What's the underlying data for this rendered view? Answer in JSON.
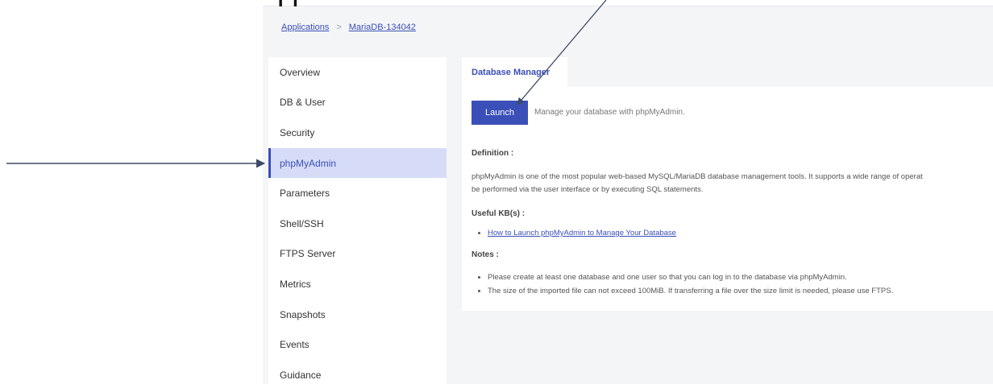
{
  "top_glyph": "[ ]",
  "breadcrumb": {
    "root": "Applications",
    "separator": ">",
    "current": "MariaDB-134042"
  },
  "sidebar": {
    "items": [
      {
        "label": "Overview"
      },
      {
        "label": "DB & User"
      },
      {
        "label": "Security"
      },
      {
        "label": "phpMyAdmin",
        "active": true
      },
      {
        "label": "Parameters"
      },
      {
        "label": "Shell/SSH"
      },
      {
        "label": "FTPS Server"
      },
      {
        "label": "Metrics"
      },
      {
        "label": "Snapshots"
      },
      {
        "label": "Events"
      },
      {
        "label": "Guidance"
      }
    ]
  },
  "tab": {
    "label": "Database Manager"
  },
  "launch": {
    "button_label": "Launch",
    "description": "Manage your database with phpMyAdmin."
  },
  "definition": {
    "heading": "Definition :",
    "line1": "phpMyAdmin is one of the most popular web-based MySQL/MariaDB database management tools. It supports a wide range of operat",
    "line2": "be performed via the user interface or by executing SQL statements."
  },
  "useful_kb": {
    "heading": "Useful KB(s) :",
    "link": "How to Launch phpMyAdmin to Manage Your Database"
  },
  "notes": {
    "heading": "Notes :",
    "items": [
      "Please create at least one database and one user so that you can log in to the database via phpMyAdmin.",
      "The size of the imported file can not exceed 100MiB. If transferring a file over the size limit is needed, please use FTPS."
    ]
  },
  "colors": {
    "accent": "#3a4fb8",
    "active_bg": "#d6dcf7",
    "annotation_arrow": "#3e4a66"
  }
}
